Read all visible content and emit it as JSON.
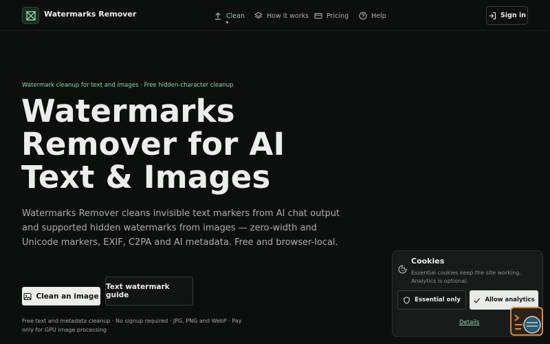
{
  "brand": {
    "name": "Watermarks Remover"
  },
  "nav": [
    {
      "label": "Clean",
      "icon": "upload-icon",
      "active": true
    },
    {
      "label": "How it works",
      "icon": "layers-icon",
      "active": false
    },
    {
      "label": "Pricing",
      "icon": "card-icon",
      "active": false
    },
    {
      "label": "Help",
      "icon": "help-icon",
      "active": false
    }
  ],
  "header": {
    "signin_label": "Sign in"
  },
  "hero": {
    "eyebrow": "Watermark cleanup for text and images · Free hidden-character cleanup",
    "title_lines": [
      "Watermarks",
      "Remover for AI",
      "Text & Images"
    ],
    "lede": "Watermarks Remover cleans invisible text markers from AI chat output and supported hidden watermarks from images — zero-width and Unicode markers, EXIF, C2PA and AI metadata. Free and browser-local.",
    "primary_cta": "Clean an image",
    "secondary_cta": "Text watermark guide",
    "footnote": "Free text and metadata cleanup · No signup required · JPG, PNG and WebP · Pay only for GPU image processing"
  },
  "cookie_banner": {
    "title": "Cookies",
    "text": "Essential cookies keep the site working. Analytics is optional.",
    "essential_label": "Essential only",
    "allow_label": "Allow analytics",
    "details_label": "Details"
  },
  "colors": {
    "background": "#0d0f0e",
    "accent": "#8fd6a8",
    "widget_border": "#d98a45"
  }
}
